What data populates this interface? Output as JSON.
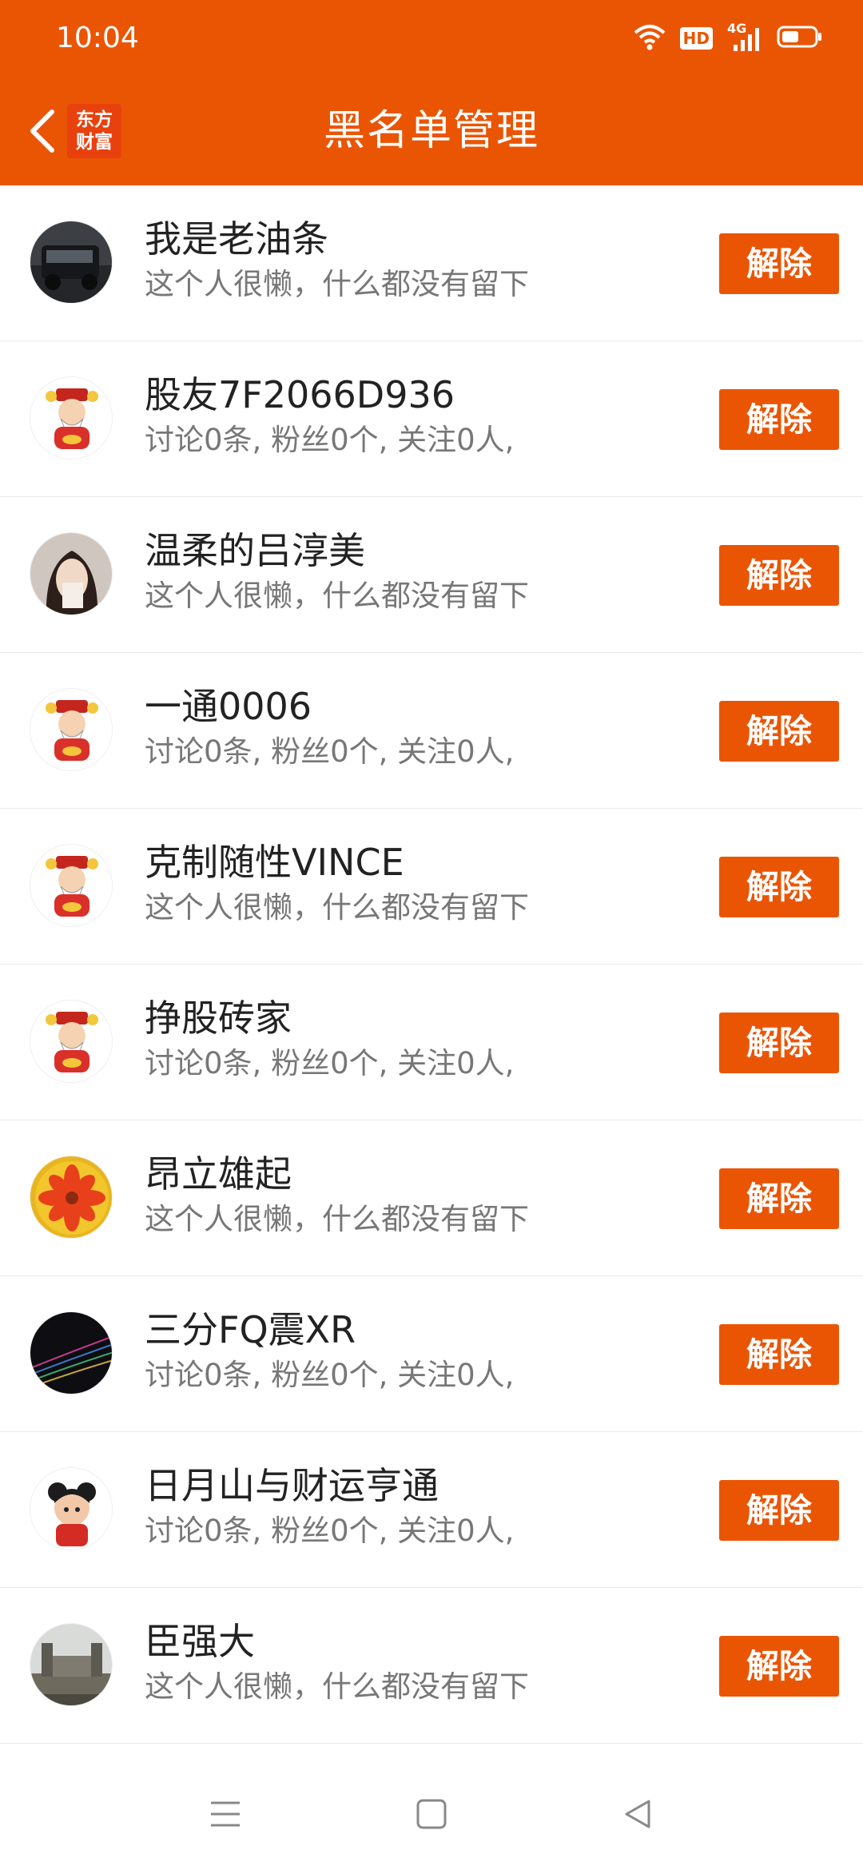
{
  "status_bar": {
    "time": "10:04",
    "icons": [
      "wifi-icon",
      "hd-icon",
      "signal-4g-icon",
      "battery-icon"
    ],
    "hd_label": "HD",
    "network_label": "4G"
  },
  "app_bar": {
    "title": "黑名单管理",
    "logo_text_line1": "东方",
    "logo_text_line2": "财富",
    "back_icon": "chevron-left-icon",
    "color": "#ea5504"
  },
  "blacklist": {
    "unblock_label": "解除",
    "items": [
      {
        "name": "我是老油条",
        "desc": "这个人很懒，什么都没有留下",
        "avatar": "car-photo"
      },
      {
        "name": "股友7F2066D936",
        "desc": "讨论0条, 粉丝0个, 关注0人,",
        "avatar": "fortune-god-default"
      },
      {
        "name": "温柔的吕淳美",
        "desc": "这个人很懒，什么都没有留下",
        "avatar": "woman-photo"
      },
      {
        "name": "一通0006",
        "desc": "讨论0条, 粉丝0个, 关注0人,",
        "avatar": "fortune-god-default"
      },
      {
        "name": "克制随性VINCE",
        "desc": "这个人很懒，什么都没有留下",
        "avatar": "fortune-god-default"
      },
      {
        "name": "挣股砖家",
        "desc": "讨论0条, 粉丝0个, 关注0人,",
        "avatar": "fortune-god-default"
      },
      {
        "name": "昂立雄起",
        "desc": "这个人很懒，什么都没有留下",
        "avatar": "flower-photo"
      },
      {
        "name": "三分FQ震XR",
        "desc": "讨论0条, 粉丝0个, 关注0人,",
        "avatar": "dark-lines"
      },
      {
        "name": "日月山与财运亨通",
        "desc": "讨论0条, 粉丝0个, 关注0人,",
        "avatar": "cartoon-child"
      },
      {
        "name": "臣强大",
        "desc": "这个人很懒，什么都没有留下",
        "avatar": "great-wall-photo"
      }
    ]
  },
  "nav_bar": {
    "buttons": [
      "menu-icon",
      "home-square-icon",
      "back-triangle-icon"
    ]
  }
}
